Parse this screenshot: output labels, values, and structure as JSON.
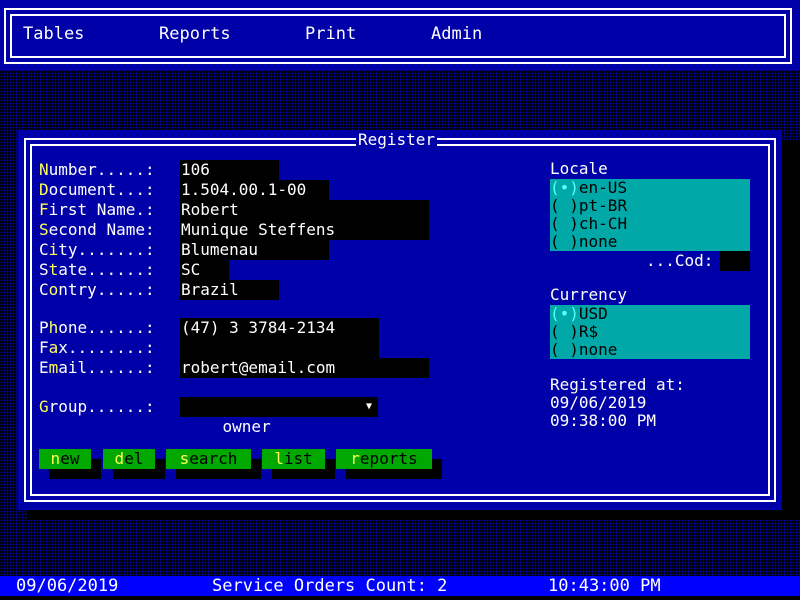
{
  "menu": {
    "items": [
      {
        "label": "Tables"
      },
      {
        "label": "Reports"
      },
      {
        "label": "Print"
      },
      {
        "label": "Admin"
      }
    ]
  },
  "dialog": {
    "title": "Register",
    "fields": {
      "number": {
        "hotkey": "N",
        "rest": "umber.....: ",
        "value": "106"
      },
      "document": {
        "hotkey": "D",
        "rest": "ocument...: ",
        "value": "1.504.00.1-00"
      },
      "first_name": {
        "hotkey": "F",
        "rest": "irst Name.: ",
        "value": "Robert"
      },
      "second_name": {
        "hotkey": "S",
        "rest": "econd Name: ",
        "value": "Munique Steffens"
      },
      "city": {
        "pre": "C",
        "hotkey": "i",
        "rest": "ty.......: ",
        "value": "Blumenau"
      },
      "state": {
        "pre": "S",
        "hotkey": "t",
        "rest": "ate......: ",
        "value": "SC"
      },
      "country": {
        "pre": "C",
        "hotkey": "o",
        "rest": "ntry.....: ",
        "value": "Brazil"
      },
      "phone": {
        "pre": "P",
        "hotkey": "h",
        "rest": "one......: ",
        "value": "(47) 3 3784-2134"
      },
      "fax": {
        "pre": "F",
        "hotkey": "a",
        "rest": "x........: ",
        "value": ""
      },
      "email": {
        "pre": "E",
        "hotkey": "m",
        "rest": "ail......: ",
        "value": "robert@email.com"
      },
      "group": {
        "hotkey": "G",
        "rest": "roup......: ",
        "value": "owner",
        "arrow": "▼"
      }
    },
    "buttons": [
      {
        "hotkey": "n",
        "rest": "ew"
      },
      {
        "hotkey": "d",
        "rest": "el"
      },
      {
        "hotkey": "s",
        "rest": "earch"
      },
      {
        "hotkey": "l",
        "rest": "ist"
      },
      {
        "hotkey": "r",
        "rest": "eports"
      }
    ],
    "locale": {
      "label": "Locale",
      "options": [
        {
          "mark": "(•)",
          "label": "en-US",
          "selected": true
        },
        {
          "mark": "( )",
          "label": "pt-BR",
          "selected": false
        },
        {
          "mark": "( )",
          "label": "ch-CH",
          "selected": false
        },
        {
          "mark": "( )",
          "label": "none",
          "selected": false
        }
      ],
      "cod_label": "...Cod:",
      "cod_value": ""
    },
    "currency": {
      "label": "Currency",
      "options": [
        {
          "mark": "(•)",
          "label": "USD",
          "selected": true
        },
        {
          "mark": "( )",
          "label": "R$",
          "selected": false
        },
        {
          "mark": "( )",
          "label": "none",
          "selected": false
        }
      ]
    },
    "registered": {
      "label": "Registered at:",
      "date": "09/06/2019",
      "time": "09:38:00 PM"
    }
  },
  "statusbar": {
    "date": "09/06/2019",
    "orders": "Service Orders Count: 2",
    "time": "10:43:00 PM"
  }
}
